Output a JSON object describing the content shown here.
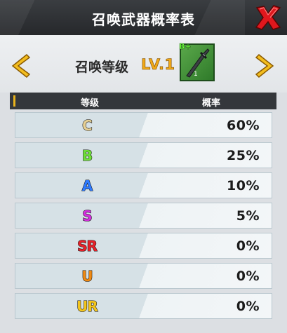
{
  "header": {
    "title": "召唤武器概率表"
  },
  "level_selector": {
    "label": "召唤等级",
    "value": "LV.1",
    "weapon_grade": "B+",
    "weapon_level": "1"
  },
  "table": {
    "columns": [
      "等级",
      "概率"
    ],
    "rows": [
      {
        "grade": "C",
        "rate": "60%",
        "color": "#e6cf93"
      },
      {
        "grade": "B",
        "rate": "25%",
        "color": "#6fe038"
      },
      {
        "grade": "A",
        "rate": "10%",
        "color": "#2f7bff"
      },
      {
        "grade": "S",
        "rate": "5%",
        "color": "#d62fe0"
      },
      {
        "grade": "SR",
        "rate": "0%",
        "color": "#e8222a"
      },
      {
        "grade": "U",
        "rate": "0%",
        "color": "#f08a14"
      },
      {
        "grade": "UR",
        "rate": "0%",
        "color": "#f3c51c"
      }
    ]
  },
  "colors": {
    "header_bg": "#2d2f33",
    "accent": "#e8b21c",
    "close": "#e0171d"
  }
}
